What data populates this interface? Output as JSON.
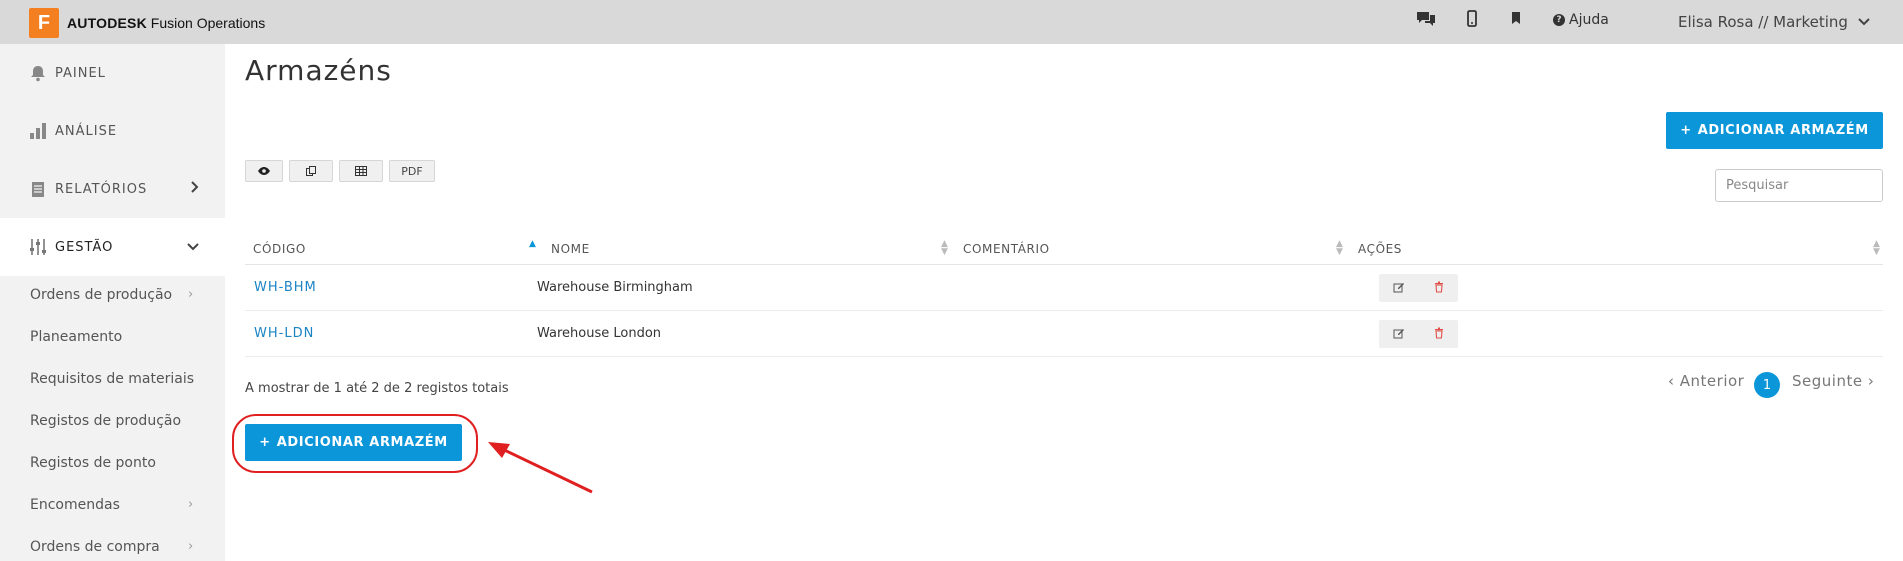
{
  "topbar": {
    "logo_letter": "F",
    "brand_bold": "AUTODESK",
    "brand_rest": " Fusion Operations",
    "icons": [
      "chat-icon",
      "mobile-icon",
      "bookmark-icon"
    ],
    "help_label": "Ajuda",
    "user_label": "Elisa Rosa // Marketing"
  },
  "sidebar": {
    "main_items": [
      {
        "label": "PAINEL",
        "icon": "bell-icon"
      },
      {
        "label": "ANÁLISE",
        "icon": "bar-chart-icon"
      },
      {
        "label": "RELATÓRIOS",
        "icon": "document-icon"
      },
      {
        "label": "GESTÃO",
        "icon": "sliders-icon"
      }
    ],
    "sub_items": [
      {
        "label": "Ordens de produção",
        "has_chevron": true
      },
      {
        "label": "Planeamento",
        "has_chevron": false
      },
      {
        "label": "Requisitos de materiais",
        "has_chevron": false
      },
      {
        "label": "Registos de produção",
        "has_chevron": false
      },
      {
        "label": "Registos de ponto",
        "has_chevron": false
      },
      {
        "label": "Encomendas",
        "has_chevron": true
      },
      {
        "label": "Ordens de compra",
        "has_chevron": true
      }
    ]
  },
  "main": {
    "title": "Armazéns",
    "add_button_label": "ADICIONAR ARMAZÉM",
    "toolbar": [
      "eye-icon",
      "copy-icon",
      "table-icon",
      "PDF"
    ],
    "search_placeholder": "Pesquisar",
    "columns": [
      "CÓDIGO",
      "NOME",
      "COMENTÁRIO",
      "AÇÕES"
    ],
    "rows": [
      {
        "code": "WH-BHM",
        "name": "Warehouse Birmingham",
        "comment": ""
      },
      {
        "code": "WH-LDN",
        "name": "Warehouse London",
        "comment": ""
      }
    ],
    "summary": "A mostrar de 1 até 2 de 2 registos totais",
    "pagination": {
      "prev": "Anterior",
      "current": "1",
      "next": "Seguinte"
    }
  },
  "colors": {
    "accent": "#0b96d9",
    "logo": "#f47f20",
    "highlight": "#e02020",
    "delete": "#e0504a"
  }
}
